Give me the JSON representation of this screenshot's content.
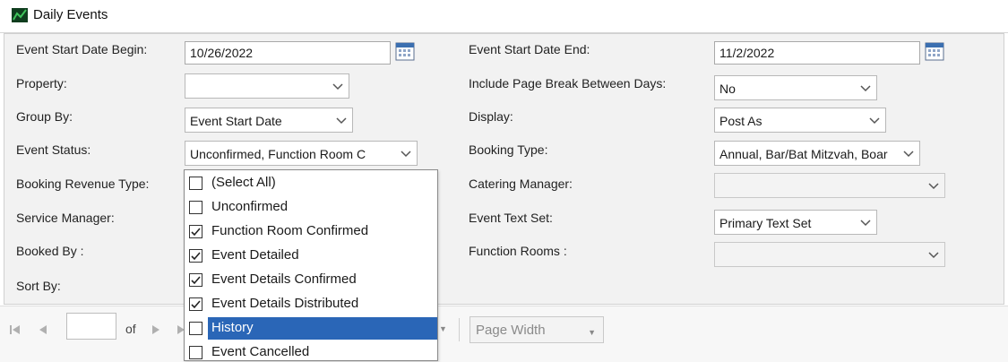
{
  "window": {
    "title": "Daily Events"
  },
  "form": {
    "start_label": "Event Start Date Begin:",
    "start_value": "10/26/2022",
    "end_label": "Event Start Date End:",
    "end_value": "11/2/2022",
    "property_label": "Property:",
    "property_value": "",
    "page_break_label": "Include Page Break Between Days:",
    "page_break_value": "No",
    "group_by_label": "Group By:",
    "group_by_value": "Event Start Date",
    "display_label": "Display:",
    "display_value": "Post As",
    "status_label": "Event Status:",
    "status_value": "Unconfirmed, Function Room C",
    "booking_type_label": "Booking Type:",
    "booking_type_value": "Annual, Bar/Bat Mitzvah, Boar",
    "revenue_type_label": "Booking Revenue Type:",
    "catering_label": "Catering Manager:",
    "catering_value": "",
    "service_label": "Service Manager:",
    "text_set_label": "Event Text Set:",
    "text_set_value": "Primary Text Set",
    "booked_by_label": "Booked By :",
    "function_rooms_label": "Function Rooms :",
    "function_rooms_value": "",
    "sort_by_label": "Sort By:"
  },
  "status_dropdown": {
    "options": [
      {
        "label": "(Select All)",
        "checked": false,
        "highlighted": false
      },
      {
        "label": "Unconfirmed",
        "checked": false,
        "highlighted": false
      },
      {
        "label": "Function Room Confirmed",
        "checked": true,
        "highlighted": false
      },
      {
        "label": "Event Detailed",
        "checked": true,
        "highlighted": false
      },
      {
        "label": "Event Details Confirmed",
        "checked": true,
        "highlighted": false
      },
      {
        "label": "Event Details Distributed",
        "checked": true,
        "highlighted": false
      },
      {
        "label": "History",
        "checked": false,
        "highlighted": true
      },
      {
        "label": "Event Cancelled",
        "checked": false,
        "highlighted": false
      }
    ]
  },
  "toolbar": {
    "page_value": "",
    "of_label": "of",
    "zoom_value": "Page Width",
    "icons": [
      "first-page-icon",
      "prev-page-icon",
      "next-page-icon",
      "last-page-icon"
    ]
  },
  "colors": {
    "highlight": "#2a66b7",
    "panel": "#f2f2f2"
  }
}
